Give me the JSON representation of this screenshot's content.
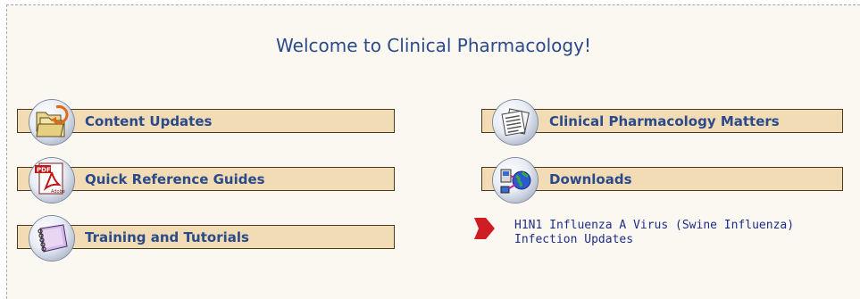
{
  "page": {
    "title": "Welcome to Clinical Pharmacology!"
  },
  "left_nav": [
    {
      "label": "Content Updates",
      "icon": "folders-update-icon"
    },
    {
      "label": "Quick Reference Guides",
      "icon": "pdf-document-icon"
    },
    {
      "label": "Training and Tutorials",
      "icon": "spiral-notebook-icon"
    }
  ],
  "right_nav": [
    {
      "label": "Clinical Pharmacology Matters",
      "icon": "newsletter-icon"
    },
    {
      "label": "Downloads",
      "icon": "globe-network-icon"
    }
  ],
  "news": {
    "link_text": "H1N1 Influenza A Virus (Swine Influenza) Infection Updates",
    "icon": "red-arrow-icon"
  },
  "colors": {
    "title": "#2b4a8a",
    "button_bg": "#f1dcb6",
    "button_border": "#4a3a20",
    "link": "#1e2d86",
    "arrow": "#d01c24",
    "panel_bg": "#fbf8f2"
  }
}
